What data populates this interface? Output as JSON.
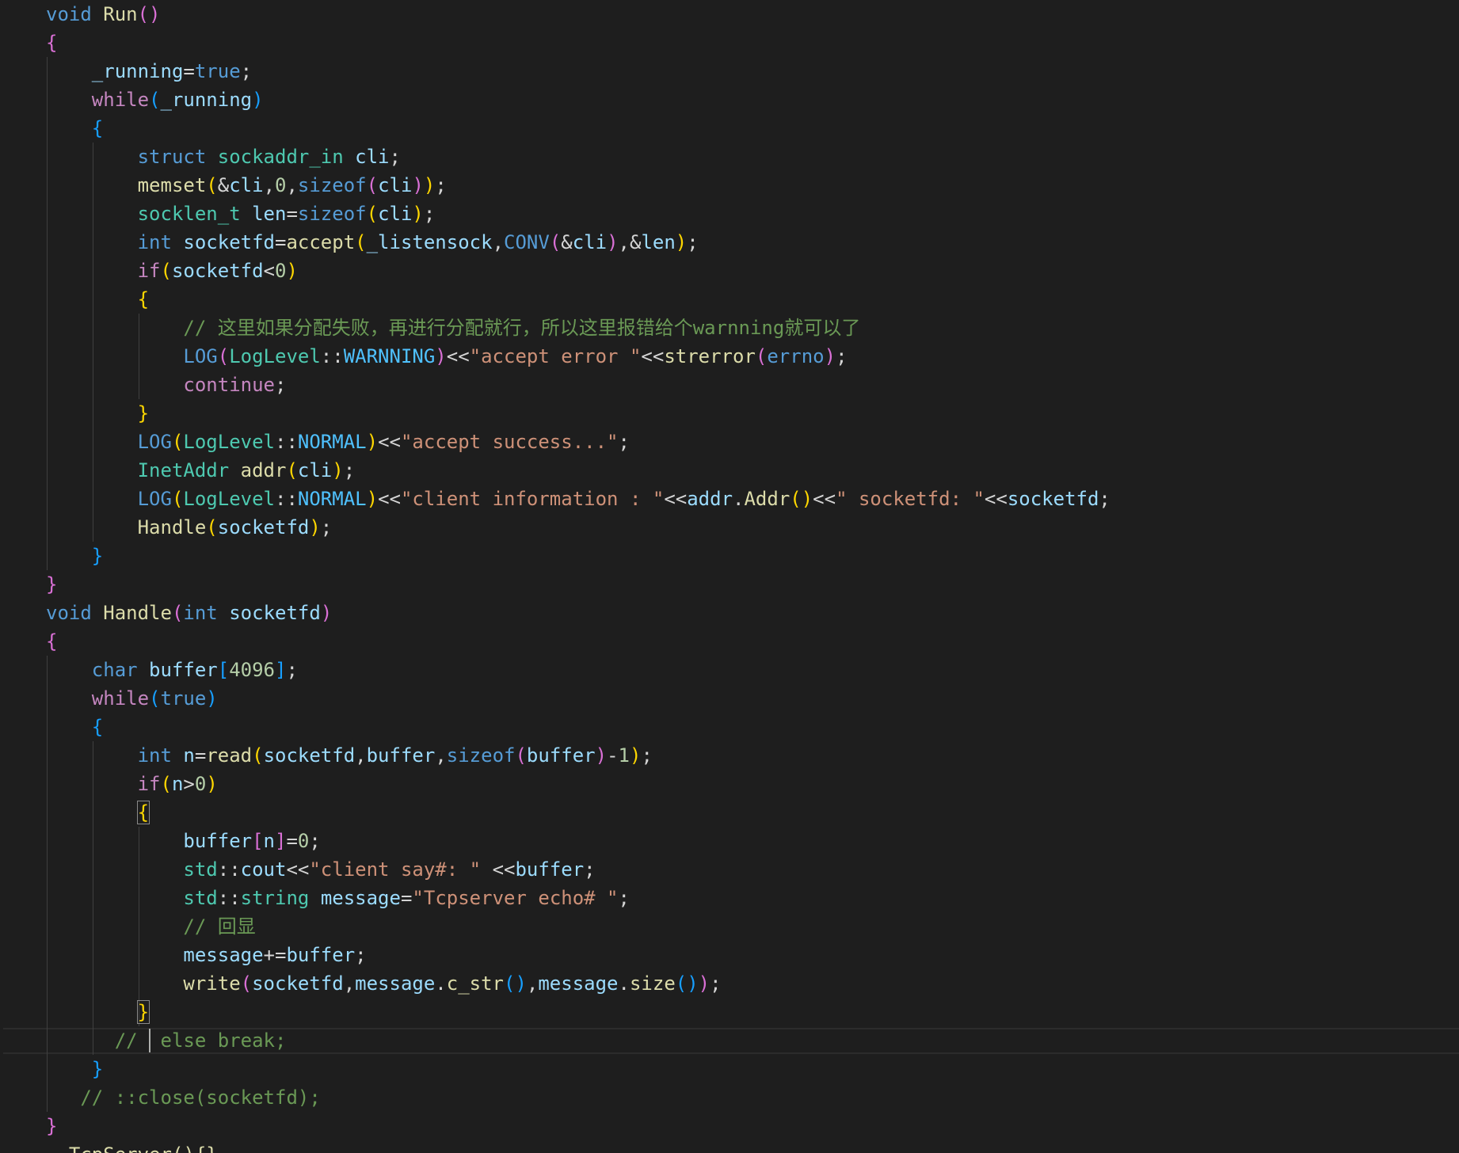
{
  "editor": {
    "theme": "dark",
    "cursor_line": 36,
    "lines": [
      [
        {
          "t": "void",
          "c": "kw"
        },
        {
          "t": " ",
          "c": "plain"
        },
        {
          "t": "Run",
          "c": "fn"
        },
        {
          "t": "()",
          "c": "b2"
        }
      ],
      [
        {
          "t": "{",
          "c": "b2"
        }
      ],
      [
        {
          "t": "    ",
          "c": "plain"
        },
        {
          "t": "_running",
          "c": "var"
        },
        {
          "t": "=",
          "c": "plain"
        },
        {
          "t": "true",
          "c": "kw"
        },
        {
          "t": ";",
          "c": "plain"
        }
      ],
      [
        {
          "t": "    ",
          "c": "plain"
        },
        {
          "t": "while",
          "c": "ctl"
        },
        {
          "t": "(",
          "c": "b3"
        },
        {
          "t": "_running",
          "c": "var"
        },
        {
          "t": ")",
          "c": "b3"
        }
      ],
      [
        {
          "t": "    ",
          "c": "plain"
        },
        {
          "t": "{",
          "c": "b3"
        }
      ],
      [
        {
          "t": "        ",
          "c": "plain"
        },
        {
          "t": "struct",
          "c": "kw"
        },
        {
          "t": " ",
          "c": "plain"
        },
        {
          "t": "sockaddr_in",
          "c": "type"
        },
        {
          "t": " ",
          "c": "plain"
        },
        {
          "t": "cli",
          "c": "var"
        },
        {
          "t": ";",
          "c": "plain"
        }
      ],
      [
        {
          "t": "        ",
          "c": "plain"
        },
        {
          "t": "memset",
          "c": "fn"
        },
        {
          "t": "(",
          "c": "b1"
        },
        {
          "t": "&",
          "c": "plain"
        },
        {
          "t": "cli",
          "c": "var"
        },
        {
          "t": ",",
          "c": "plain"
        },
        {
          "t": "0",
          "c": "num"
        },
        {
          "t": ",",
          "c": "plain"
        },
        {
          "t": "sizeof",
          "c": "kw"
        },
        {
          "t": "(",
          "c": "b2"
        },
        {
          "t": "cli",
          "c": "var"
        },
        {
          "t": ")",
          "c": "b2"
        },
        {
          "t": ")",
          "c": "b1"
        },
        {
          "t": ";",
          "c": "plain"
        }
      ],
      [
        {
          "t": "        ",
          "c": "plain"
        },
        {
          "t": "socklen_t",
          "c": "type"
        },
        {
          "t": " ",
          "c": "plain"
        },
        {
          "t": "len",
          "c": "var"
        },
        {
          "t": "=",
          "c": "plain"
        },
        {
          "t": "sizeof",
          "c": "kw"
        },
        {
          "t": "(",
          "c": "b1"
        },
        {
          "t": "cli",
          "c": "var"
        },
        {
          "t": ")",
          "c": "b1"
        },
        {
          "t": ";",
          "c": "plain"
        }
      ],
      [
        {
          "t": "        ",
          "c": "plain"
        },
        {
          "t": "int",
          "c": "kw"
        },
        {
          "t": " ",
          "c": "plain"
        },
        {
          "t": "socketfd",
          "c": "var"
        },
        {
          "t": "=",
          "c": "plain"
        },
        {
          "t": "accept",
          "c": "fn"
        },
        {
          "t": "(",
          "c": "b1"
        },
        {
          "t": "_listensock",
          "c": "var"
        },
        {
          "t": ",",
          "c": "plain"
        },
        {
          "t": "CONV",
          "c": "kw"
        },
        {
          "t": "(",
          "c": "b2"
        },
        {
          "t": "&",
          "c": "plain"
        },
        {
          "t": "cli",
          "c": "var"
        },
        {
          "t": ")",
          "c": "b2"
        },
        {
          "t": ",",
          "c": "plain"
        },
        {
          "t": "&",
          "c": "plain"
        },
        {
          "t": "len",
          "c": "var"
        },
        {
          "t": ")",
          "c": "b1"
        },
        {
          "t": ";",
          "c": "plain"
        }
      ],
      [
        {
          "t": "        ",
          "c": "plain"
        },
        {
          "t": "if",
          "c": "ctl"
        },
        {
          "t": "(",
          "c": "b1"
        },
        {
          "t": "socketfd",
          "c": "var"
        },
        {
          "t": "<",
          "c": "plain"
        },
        {
          "t": "0",
          "c": "num"
        },
        {
          "t": ")",
          "c": "b1"
        }
      ],
      [
        {
          "t": "        ",
          "c": "plain"
        },
        {
          "t": "{",
          "c": "b1"
        }
      ],
      [
        {
          "t": "            ",
          "c": "plain"
        },
        {
          "t": "// 这里如果分配失败，再进行分配就行，所以这里报错给个warnning就可以了",
          "c": "cmt"
        }
      ],
      [
        {
          "t": "            ",
          "c": "plain"
        },
        {
          "t": "LOG",
          "c": "kw"
        },
        {
          "t": "(",
          "c": "b2"
        },
        {
          "t": "LogLevel",
          "c": "type"
        },
        {
          "t": "::",
          "c": "plain"
        },
        {
          "t": "WARNNING",
          "c": "const"
        },
        {
          "t": ")",
          "c": "b2"
        },
        {
          "t": "<<",
          "c": "plain"
        },
        {
          "t": "\"accept error \"",
          "c": "str"
        },
        {
          "t": "<<",
          "c": "plain"
        },
        {
          "t": "strerror",
          "c": "fn"
        },
        {
          "t": "(",
          "c": "b2"
        },
        {
          "t": "errno",
          "c": "kw"
        },
        {
          "t": ")",
          "c": "b2"
        },
        {
          "t": ";",
          "c": "plain"
        }
      ],
      [
        {
          "t": "            ",
          "c": "plain"
        },
        {
          "t": "continue",
          "c": "ctl"
        },
        {
          "t": ";",
          "c": "plain"
        }
      ],
      [
        {
          "t": "        ",
          "c": "plain"
        },
        {
          "t": "}",
          "c": "b1"
        }
      ],
      [
        {
          "t": "        ",
          "c": "plain"
        },
        {
          "t": "LOG",
          "c": "kw"
        },
        {
          "t": "(",
          "c": "b1"
        },
        {
          "t": "LogLevel",
          "c": "type"
        },
        {
          "t": "::",
          "c": "plain"
        },
        {
          "t": "NORMAL",
          "c": "const"
        },
        {
          "t": ")",
          "c": "b1"
        },
        {
          "t": "<<",
          "c": "plain"
        },
        {
          "t": "\"accept success...\"",
          "c": "str"
        },
        {
          "t": ";",
          "c": "plain"
        }
      ],
      [
        {
          "t": "        ",
          "c": "plain"
        },
        {
          "t": "InetAddr",
          "c": "type"
        },
        {
          "t": " ",
          "c": "plain"
        },
        {
          "t": "addr",
          "c": "fn"
        },
        {
          "t": "(",
          "c": "b1"
        },
        {
          "t": "cli",
          "c": "var"
        },
        {
          "t": ")",
          "c": "b1"
        },
        {
          "t": ";",
          "c": "plain"
        }
      ],
      [
        {
          "t": "        ",
          "c": "plain"
        },
        {
          "t": "LOG",
          "c": "kw"
        },
        {
          "t": "(",
          "c": "b1"
        },
        {
          "t": "LogLevel",
          "c": "type"
        },
        {
          "t": "::",
          "c": "plain"
        },
        {
          "t": "NORMAL",
          "c": "const"
        },
        {
          "t": ")",
          "c": "b1"
        },
        {
          "t": "<<",
          "c": "plain"
        },
        {
          "t": "\"client information : \"",
          "c": "str"
        },
        {
          "t": "<<",
          "c": "plain"
        },
        {
          "t": "addr",
          "c": "var"
        },
        {
          "t": ".",
          "c": "plain"
        },
        {
          "t": "Addr",
          "c": "fn"
        },
        {
          "t": "()",
          "c": "b1"
        },
        {
          "t": "<<",
          "c": "plain"
        },
        {
          "t": "\" socketfd: \"",
          "c": "str"
        },
        {
          "t": "<<",
          "c": "plain"
        },
        {
          "t": "socketfd",
          "c": "var"
        },
        {
          "t": ";",
          "c": "plain"
        }
      ],
      [
        {
          "t": "        ",
          "c": "plain"
        },
        {
          "t": "Handle",
          "c": "fn"
        },
        {
          "t": "(",
          "c": "b1"
        },
        {
          "t": "socketfd",
          "c": "var"
        },
        {
          "t": ")",
          "c": "b1"
        },
        {
          "t": ";",
          "c": "plain"
        }
      ],
      [
        {
          "t": "    ",
          "c": "plain"
        },
        {
          "t": "}",
          "c": "b3"
        }
      ],
      [
        {
          "t": "}",
          "c": "b2"
        }
      ],
      [
        {
          "t": "void",
          "c": "kw"
        },
        {
          "t": " ",
          "c": "plain"
        },
        {
          "t": "Handle",
          "c": "fn"
        },
        {
          "t": "(",
          "c": "b2"
        },
        {
          "t": "int",
          "c": "kw"
        },
        {
          "t": " ",
          "c": "plain"
        },
        {
          "t": "socketfd",
          "c": "var"
        },
        {
          "t": ")",
          "c": "b2"
        }
      ],
      [
        {
          "t": "{",
          "c": "b2"
        }
      ],
      [
        {
          "t": "    ",
          "c": "plain"
        },
        {
          "t": "char",
          "c": "kw"
        },
        {
          "t": " ",
          "c": "plain"
        },
        {
          "t": "buffer",
          "c": "var"
        },
        {
          "t": "[",
          "c": "b3"
        },
        {
          "t": "4096",
          "c": "num"
        },
        {
          "t": "]",
          "c": "b3"
        },
        {
          "t": ";",
          "c": "plain"
        }
      ],
      [
        {
          "t": "    ",
          "c": "plain"
        },
        {
          "t": "while",
          "c": "ctl"
        },
        {
          "t": "(",
          "c": "b3"
        },
        {
          "t": "true",
          "c": "kw"
        },
        {
          "t": ")",
          "c": "b3"
        }
      ],
      [
        {
          "t": "    ",
          "c": "plain"
        },
        {
          "t": "{",
          "c": "b3"
        }
      ],
      [
        {
          "t": "        ",
          "c": "plain"
        },
        {
          "t": "int",
          "c": "kw"
        },
        {
          "t": " ",
          "c": "plain"
        },
        {
          "t": "n",
          "c": "var"
        },
        {
          "t": "=",
          "c": "plain"
        },
        {
          "t": "read",
          "c": "fn"
        },
        {
          "t": "(",
          "c": "b1"
        },
        {
          "t": "socketfd",
          "c": "var"
        },
        {
          "t": ",",
          "c": "plain"
        },
        {
          "t": "buffer",
          "c": "var"
        },
        {
          "t": ",",
          "c": "plain"
        },
        {
          "t": "sizeof",
          "c": "kw"
        },
        {
          "t": "(",
          "c": "b2"
        },
        {
          "t": "buffer",
          "c": "var"
        },
        {
          "t": ")",
          "c": "b2"
        },
        {
          "t": "-",
          "c": "plain"
        },
        {
          "t": "1",
          "c": "num"
        },
        {
          "t": ")",
          "c": "b1"
        },
        {
          "t": ";",
          "c": "plain"
        }
      ],
      [
        {
          "t": "        ",
          "c": "plain"
        },
        {
          "t": "if",
          "c": "ctl"
        },
        {
          "t": "(",
          "c": "b1"
        },
        {
          "t": "n",
          "c": "var"
        },
        {
          "t": ">",
          "c": "plain"
        },
        {
          "t": "0",
          "c": "num"
        },
        {
          "t": ")",
          "c": "b1"
        }
      ],
      [
        {
          "t": "        ",
          "c": "plain"
        },
        {
          "t": "{",
          "c": "b1",
          "box": true
        }
      ],
      [
        {
          "t": "            ",
          "c": "plain"
        },
        {
          "t": "buffer",
          "c": "var"
        },
        {
          "t": "[",
          "c": "b2"
        },
        {
          "t": "n",
          "c": "var"
        },
        {
          "t": "]",
          "c": "b2"
        },
        {
          "t": "=",
          "c": "plain"
        },
        {
          "t": "0",
          "c": "num"
        },
        {
          "t": ";",
          "c": "plain"
        }
      ],
      [
        {
          "t": "            ",
          "c": "plain"
        },
        {
          "t": "std",
          "c": "type"
        },
        {
          "t": "::",
          "c": "plain"
        },
        {
          "t": "cout",
          "c": "var"
        },
        {
          "t": "<<",
          "c": "plain"
        },
        {
          "t": "\"client say#: \"",
          "c": "str"
        },
        {
          "t": " ",
          "c": "plain"
        },
        {
          "t": "<<",
          "c": "plain"
        },
        {
          "t": "buffer",
          "c": "var"
        },
        {
          "t": ";",
          "c": "plain"
        }
      ],
      [
        {
          "t": "            ",
          "c": "plain"
        },
        {
          "t": "std",
          "c": "type"
        },
        {
          "t": "::",
          "c": "plain"
        },
        {
          "t": "string",
          "c": "type"
        },
        {
          "t": " ",
          "c": "plain"
        },
        {
          "t": "message",
          "c": "var"
        },
        {
          "t": "=",
          "c": "plain"
        },
        {
          "t": "\"Tcpserver echo# \"",
          "c": "str"
        },
        {
          "t": ";",
          "c": "plain"
        }
      ],
      [
        {
          "t": "            ",
          "c": "plain"
        },
        {
          "t": "// 回显",
          "c": "cmt"
        }
      ],
      [
        {
          "t": "            ",
          "c": "plain"
        },
        {
          "t": "message",
          "c": "var"
        },
        {
          "t": "+=",
          "c": "plain"
        },
        {
          "t": "buffer",
          "c": "var"
        },
        {
          "t": ";",
          "c": "plain"
        }
      ],
      [
        {
          "t": "            ",
          "c": "plain"
        },
        {
          "t": "write",
          "c": "fn"
        },
        {
          "t": "(",
          "c": "b2"
        },
        {
          "t": "socketfd",
          "c": "var"
        },
        {
          "t": ",",
          "c": "plain"
        },
        {
          "t": "message",
          "c": "var"
        },
        {
          "t": ".",
          "c": "plain"
        },
        {
          "t": "c_str",
          "c": "fn"
        },
        {
          "t": "()",
          "c": "b3"
        },
        {
          "t": ",",
          "c": "plain"
        },
        {
          "t": "message",
          "c": "var"
        },
        {
          "t": ".",
          "c": "plain"
        },
        {
          "t": "size",
          "c": "fn"
        },
        {
          "t": "()",
          "c": "b3"
        },
        {
          "t": ")",
          "c": "b2"
        },
        {
          "t": ";",
          "c": "plain"
        }
      ],
      [
        {
          "t": "        ",
          "c": "plain"
        },
        {
          "t": "}",
          "c": "b1",
          "box": true
        }
      ],
      [
        {
          "t": "      ",
          "c": "plain"
        },
        {
          "t": "//  else break;",
          "c": "cmt"
        }
      ],
      [
        {
          "t": "    ",
          "c": "plain"
        },
        {
          "t": "}",
          "c": "b3"
        }
      ],
      [
        {
          "t": "   ",
          "c": "plain"
        },
        {
          "t": "// ::close(socketfd);",
          "c": "cmt"
        }
      ],
      [
        {
          "t": "}",
          "c": "b2"
        }
      ],
      [
        {
          "t": " ~TcpServer(){}",
          "c": "fn"
        }
      ]
    ]
  }
}
